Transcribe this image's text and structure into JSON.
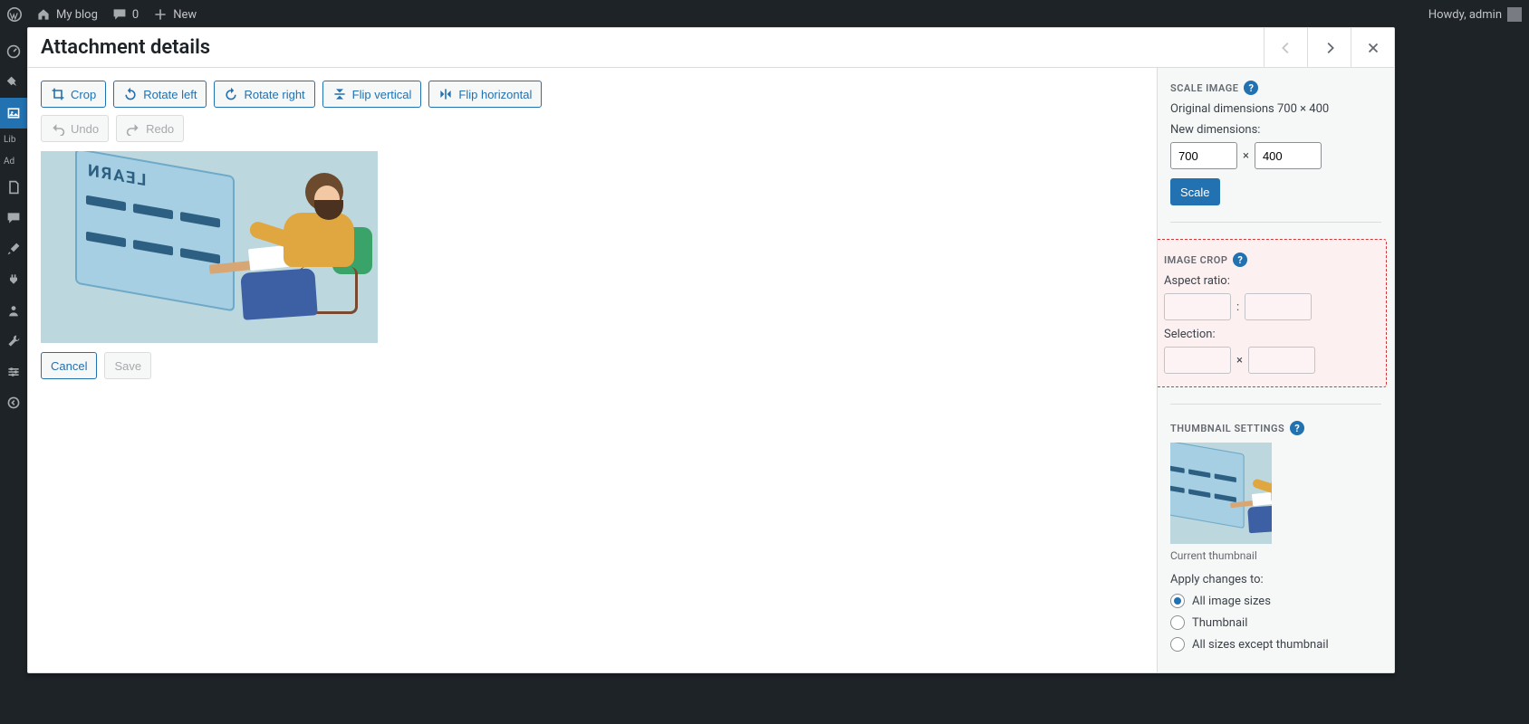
{
  "adminBar": {
    "siteLabel": "My blog",
    "commentsCount": "0",
    "newLabel": "New",
    "howdy": "Howdy, admin"
  },
  "adminMenu": {
    "textLabels": [
      "Lib",
      "Ad"
    ]
  },
  "modal": {
    "title": "Attachment details",
    "prevDisabled": true,
    "nextDisabled": false,
    "toolbar": {
      "crop": "Crop",
      "rotateLeft": "Rotate left",
      "rotateRight": "Rotate right",
      "flipVertical": "Flip vertical",
      "flipHorizontal": "Flip horizontal",
      "undo": "Undo",
      "redo": "Redo"
    },
    "boardText": "LEARN",
    "actions": {
      "cancel": "Cancel",
      "save": "Save"
    }
  },
  "settings": {
    "scale": {
      "title": "SCALE IMAGE",
      "originalLabel": "Original dimensions 700 × 400",
      "newDimsLabel": "New dimensions:",
      "width": "700",
      "height": "400",
      "separator": "×",
      "button": "Scale"
    },
    "crop": {
      "title": "IMAGE CROP",
      "aspectLabel": "Aspect ratio:",
      "aspectSep": ":",
      "selectionLabel": "Selection:",
      "selectionSep": "×"
    },
    "thumb": {
      "title": "THUMBNAIL SETTINGS",
      "caption": "Current thumbnail",
      "applyLabel": "Apply changes to:",
      "options": {
        "all": "All image sizes",
        "thumbnail": "Thumbnail",
        "except": "All sizes except thumbnail"
      },
      "selected": "all"
    },
    "helpGlyph": "?"
  }
}
